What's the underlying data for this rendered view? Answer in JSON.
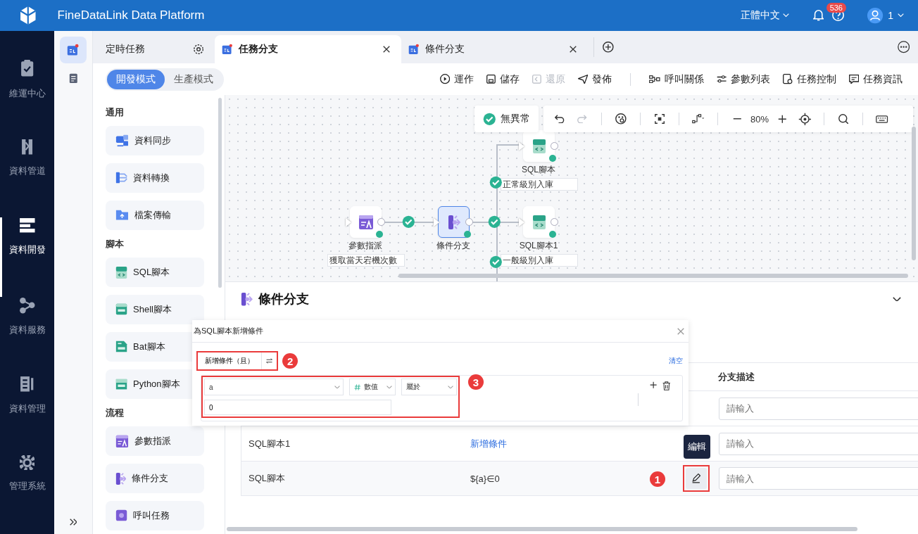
{
  "header": {
    "title": "FineDataLink Data Platform",
    "language": "正體中文",
    "notifications": "536",
    "user": "1"
  },
  "nav": [
    {
      "label": "維運中心",
      "selected": false
    },
    {
      "label": "資料管道",
      "selected": false
    },
    {
      "label": "資料開發",
      "selected": true
    },
    {
      "label": "資料服務",
      "selected": false
    },
    {
      "label": "資料管理",
      "selected": false
    },
    {
      "label": "管理系統",
      "selected": false
    }
  ],
  "subnav": [
    {
      "selected": true
    },
    {
      "selected": false
    }
  ],
  "tabs": [
    {
      "label": "定時任務",
      "kind": "settings",
      "selected": false
    },
    {
      "label": "任務分支",
      "kind": "task",
      "selected": true
    },
    {
      "label": "條件分支",
      "kind": "task",
      "selected": false
    }
  ],
  "modes": [
    {
      "label": "開發模式",
      "selected": true
    },
    {
      "label": "生產模式",
      "selected": false
    }
  ],
  "actions": [
    {
      "label": "運作",
      "disabled": false,
      "divider_after": false
    },
    {
      "label": "儲存",
      "disabled": false,
      "divider_after": false
    },
    {
      "label": "還原",
      "disabled": true,
      "divider_after": false
    },
    {
      "label": "發佈",
      "disabled": false,
      "divider_after": true
    },
    {
      "label": "呼叫關係",
      "disabled": false,
      "divider_after": false
    },
    {
      "label": "參數列表",
      "disabled": false,
      "divider_after": false
    },
    {
      "label": "任務控制",
      "disabled": false,
      "divider_after": false
    },
    {
      "label": "任務資訊",
      "disabled": false,
      "divider_after": false
    }
  ],
  "palette": [
    {
      "title": "通用",
      "items": [
        {
          "label": "資料同步"
        },
        {
          "label": "資料轉換"
        },
        {
          "label": "檔案傳輸"
        }
      ]
    },
    {
      "title": "腳本",
      "items": [
        {
          "label": "SQL腳本"
        },
        {
          "label": "Shell腳本"
        },
        {
          "label": "Bat腳本"
        },
        {
          "label": "Python腳本"
        }
      ]
    },
    {
      "title": "流程",
      "items": [
        {
          "label": "參數指派"
        },
        {
          "label": "條件分支"
        },
        {
          "label": "呼叫任務"
        }
      ]
    }
  ],
  "canvas": {
    "status": "無異常",
    "zoom": "80%",
    "redo_disabled": true,
    "nodes": [
      {
        "label": "參數指派",
        "selected": false,
        "description": "獲取當天宕機次數"
      },
      {
        "label": "條件分支",
        "selected": true
      },
      {
        "label": "SQL腳本",
        "selected": false,
        "description": "正常級別入庫"
      },
      {
        "label": "SQL腳本1",
        "selected": false,
        "description": "一般級別入庫"
      }
    ]
  },
  "panel": {
    "title": "條件分支",
    "description_header": "分支描述",
    "rows": [
      {
        "kind": "blank",
        "placeholder": "請輸入"
      },
      {
        "kind": "link",
        "name": "SQL腳本1",
        "condition": "新增條件",
        "placeholder": "請輸入"
      },
      {
        "kind": "text",
        "name": "SQL腳本",
        "condition": "${a}∈0",
        "placeholder": "請輸入",
        "edit_tooltip": "編輯",
        "callout": "1"
      }
    ]
  },
  "dialog": {
    "title": "為SQL腳本新增條件",
    "add_button": "新增條件（且）",
    "add_callout": "2",
    "clear": "清空",
    "condition_callout": "3",
    "condition": {
      "field": "a",
      "type": "數值",
      "operator": "屬於",
      "value": "0"
    }
  }
}
